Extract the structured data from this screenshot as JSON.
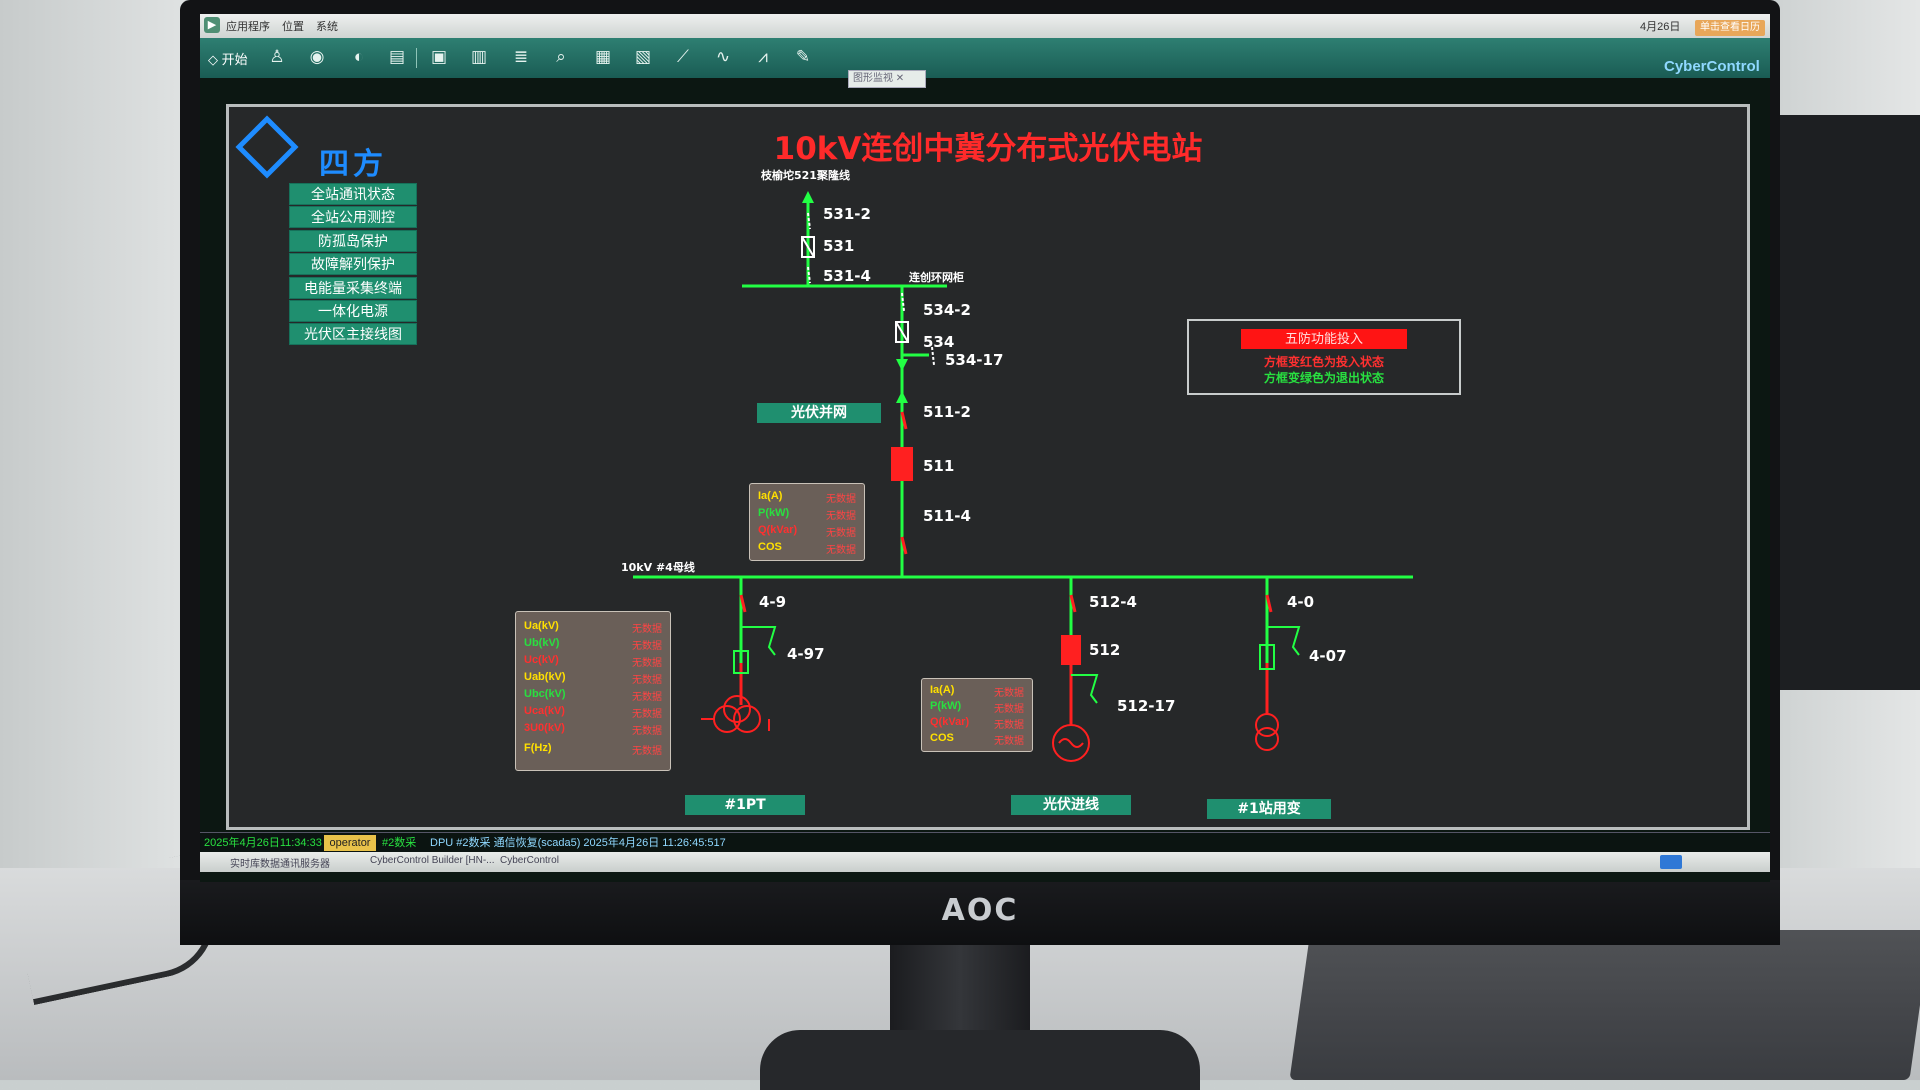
{
  "menubar": {
    "items": [
      "应用程序",
      "位置",
      "系统"
    ],
    "date": "4月26日",
    "notify": "单击查看日历"
  },
  "toolbar": {
    "start_label": "开始",
    "tab_label": "图形监视",
    "brand": "CyberControl"
  },
  "header": {
    "logo_text": "四方",
    "title": "10kV连创中冀分布式光伏电站"
  },
  "nav": {
    "items": [
      "全站通讯状态",
      "全站公用测控",
      "防孤岛保护",
      "故障解列保护",
      "电能量采集终端",
      "一体化电源",
      "光伏区主接线图"
    ]
  },
  "function_box": {
    "bar_label": "五防功能投入",
    "note_red": "方框变红色为投入状态",
    "note_green": "方框变绿色为退出状态"
  },
  "diagram": {
    "line_top": "枝榆坨521聚隆线",
    "ring_cabinet": "连创环网柜",
    "bus_label": "10kV #4母线",
    "pv_grid_tag": "光伏并网",
    "pt_tag": "#1PT",
    "pv_line_tag": "光伏进线",
    "station_tx_tag": "#1站用变",
    "switches": [
      "531-2",
      "531",
      "531-4",
      "534-2",
      "534",
      "534-17",
      "511-2",
      "511",
      "511-4",
      "4-9",
      "4-97",
      "512-4",
      "512",
      "512-17",
      "4-0",
      "4-07"
    ]
  },
  "panels": {
    "p511": {
      "rows": [
        "Ia(A)",
        "P(kW)",
        "Q(kVar)",
        "COS"
      ],
      "values": [
        "无数据",
        "无数据",
        "无数据",
        "无数据"
      ]
    },
    "p512": {
      "rows": [
        "Ia(A)",
        "P(kW)",
        "Q(kVar)",
        "COS"
      ],
      "values": [
        "无数据",
        "无数据",
        "无数据",
        "无数据"
      ]
    },
    "pt": {
      "rows": [
        "Ua(kV)",
        "Ub(kV)",
        "Uc(kV)",
        "Uab(kV)",
        "Ubc(kV)",
        "Uca(kV)",
        "3U0(kV)",
        "F(Hz)"
      ],
      "values": [
        "无数据",
        "无数据",
        "无数据",
        "无数据",
        "无数据",
        "无数据",
        "无数据",
        "无数据"
      ]
    }
  },
  "statusbar": {
    "datetime": "2025年4月26日11:34:33",
    "user": "operator",
    "node": "#2数采",
    "message": "DPU #2数采 通信恢复(scada5) 2025年4月26日 11:26:45:517"
  },
  "taskbar": {
    "items": [
      "实时库数据通讯服务器",
      "CyberControl Builder [HN-...",
      "CyberControl"
    ]
  },
  "monitor_brand": "AOC",
  "colors": {
    "energized": "#22ff44",
    "breaker_closed": "#ff2020",
    "button": "#1f8f6f",
    "title": "#ff2a2a"
  }
}
